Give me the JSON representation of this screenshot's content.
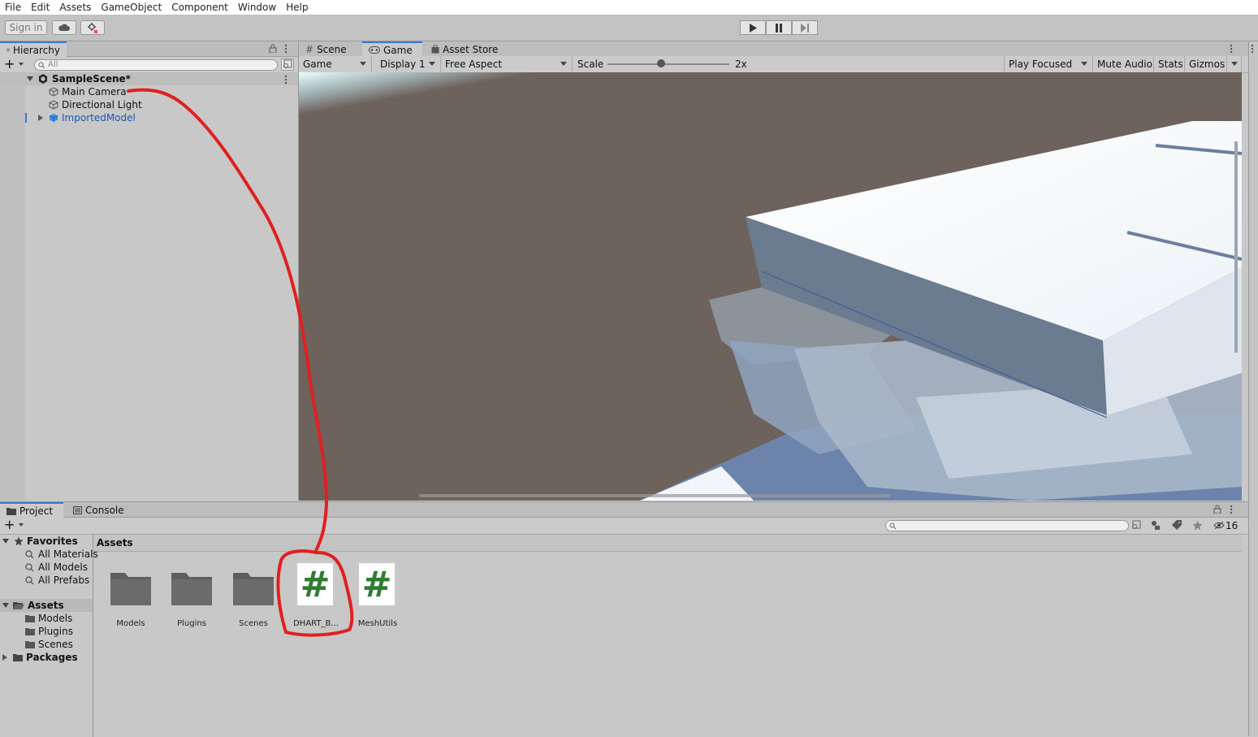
{
  "menu": [
    "File",
    "Edit",
    "Assets",
    "GameObject",
    "Component",
    "Window",
    "Help"
  ],
  "toolbar": {
    "sign_in": "Sign in"
  },
  "hierarchy": {
    "tab": "Hierarchy",
    "search_placeholder": "All",
    "scene": "SampleScene*",
    "items": [
      "Main Camera",
      "Directional Light",
      "ImportedModel"
    ]
  },
  "view_tabs": [
    "Scene",
    "Game",
    "Asset Store"
  ],
  "game_bar": {
    "mode": "Game",
    "display": "Display 1",
    "aspect": "Free Aspect",
    "scale_label": "Scale",
    "scale_value": "2x",
    "scale_fraction": 0.44,
    "play_focused": "Play Focused",
    "mute": "Mute Audio",
    "stats": "Stats",
    "gizmos": "Gizmos"
  },
  "bottom_tabs": [
    "Project",
    "Console"
  ],
  "project": {
    "favorites_label": "Favorites",
    "favorites": [
      "All Materials",
      "All Models",
      "All Prefabs"
    ],
    "assets_label": "Assets",
    "asset_folders": [
      "Models",
      "Plugins",
      "Scenes"
    ],
    "packages_label": "Packages",
    "breadcrumb": "Assets",
    "hidden_count": "16",
    "grid": [
      {
        "name": "Models",
        "kind": "folder"
      },
      {
        "name": "Plugins",
        "kind": "folder"
      },
      {
        "name": "Scenes",
        "kind": "folder"
      },
      {
        "name": "DHART_B...",
        "kind": "script"
      },
      {
        "name": "MeshUtils",
        "kind": "script"
      }
    ],
    "script_glyph": "#"
  },
  "colors": {
    "accent": "#3a79d7",
    "script_green": "#2f7d32",
    "annotation": "#e02020",
    "ground": "#6e625d"
  }
}
